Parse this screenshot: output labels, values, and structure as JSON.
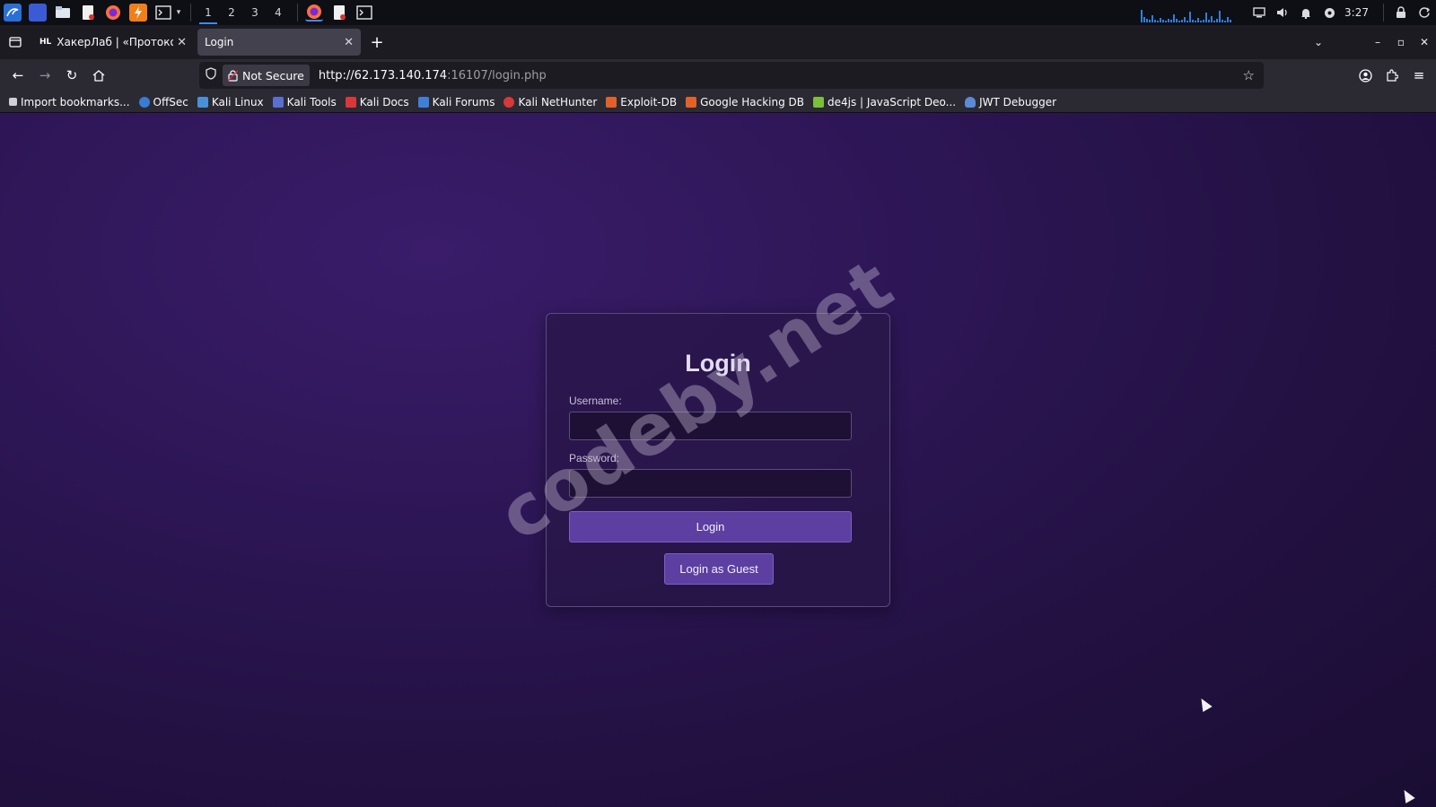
{
  "taskbar": {
    "workspaces": [
      "1",
      "2",
      "3",
      "4"
    ],
    "active_workspace": "1",
    "clock": "3:27",
    "accent_color": "#3d8bff"
  },
  "browser": {
    "tabs": [
      {
        "favicon": "HL",
        "title": "ХакерЛаб | «Протокол \"З",
        "active": false
      },
      {
        "favicon": "",
        "title": "Login",
        "active": true
      }
    ],
    "new_tab_icon": "plus-icon",
    "security_label": "Not Secure",
    "url_host": "http://62.173.140.174",
    "url_rest": ":16107/login.php",
    "bookmarks": [
      {
        "label": "Import bookmarks...",
        "icon": "import-icon",
        "color": "#cfcfd8"
      },
      {
        "label": "OffSec",
        "icon": "offsec-icon",
        "color": "#3a7bd5"
      },
      {
        "label": "Kali Linux",
        "icon": "kali-icon",
        "color": "#4a90d9"
      },
      {
        "label": "Kali Tools",
        "icon": "kali-tools-icon",
        "color": "#5a6fd0"
      },
      {
        "label": "Kali Docs",
        "icon": "kali-docs-icon",
        "color": "#d9383a"
      },
      {
        "label": "Kali Forums",
        "icon": "kali-forums-icon",
        "color": "#3f7fd8"
      },
      {
        "label": "Kali NetHunter",
        "icon": "nethunter-icon",
        "color": "#d9383a"
      },
      {
        "label": "Exploit-DB",
        "icon": "exploitdb-icon",
        "color": "#e0622a"
      },
      {
        "label": "Google Hacking DB",
        "icon": "ghdb-icon",
        "color": "#e0622a"
      },
      {
        "label": "de4js | JavaScript Deo...",
        "icon": "de4js-icon",
        "color": "#7bbf3a"
      },
      {
        "label": "JWT Debugger",
        "icon": "jwt-icon",
        "color": "#5b8ad6"
      }
    ]
  },
  "page": {
    "title": "Login",
    "username_label": "Username:",
    "password_label": "Password:",
    "username_value": "",
    "password_value": "",
    "login_button": "Login",
    "guest_button": "Login as Guest",
    "watermark": "codeby.net",
    "accent_color": "#5c3fa0"
  }
}
